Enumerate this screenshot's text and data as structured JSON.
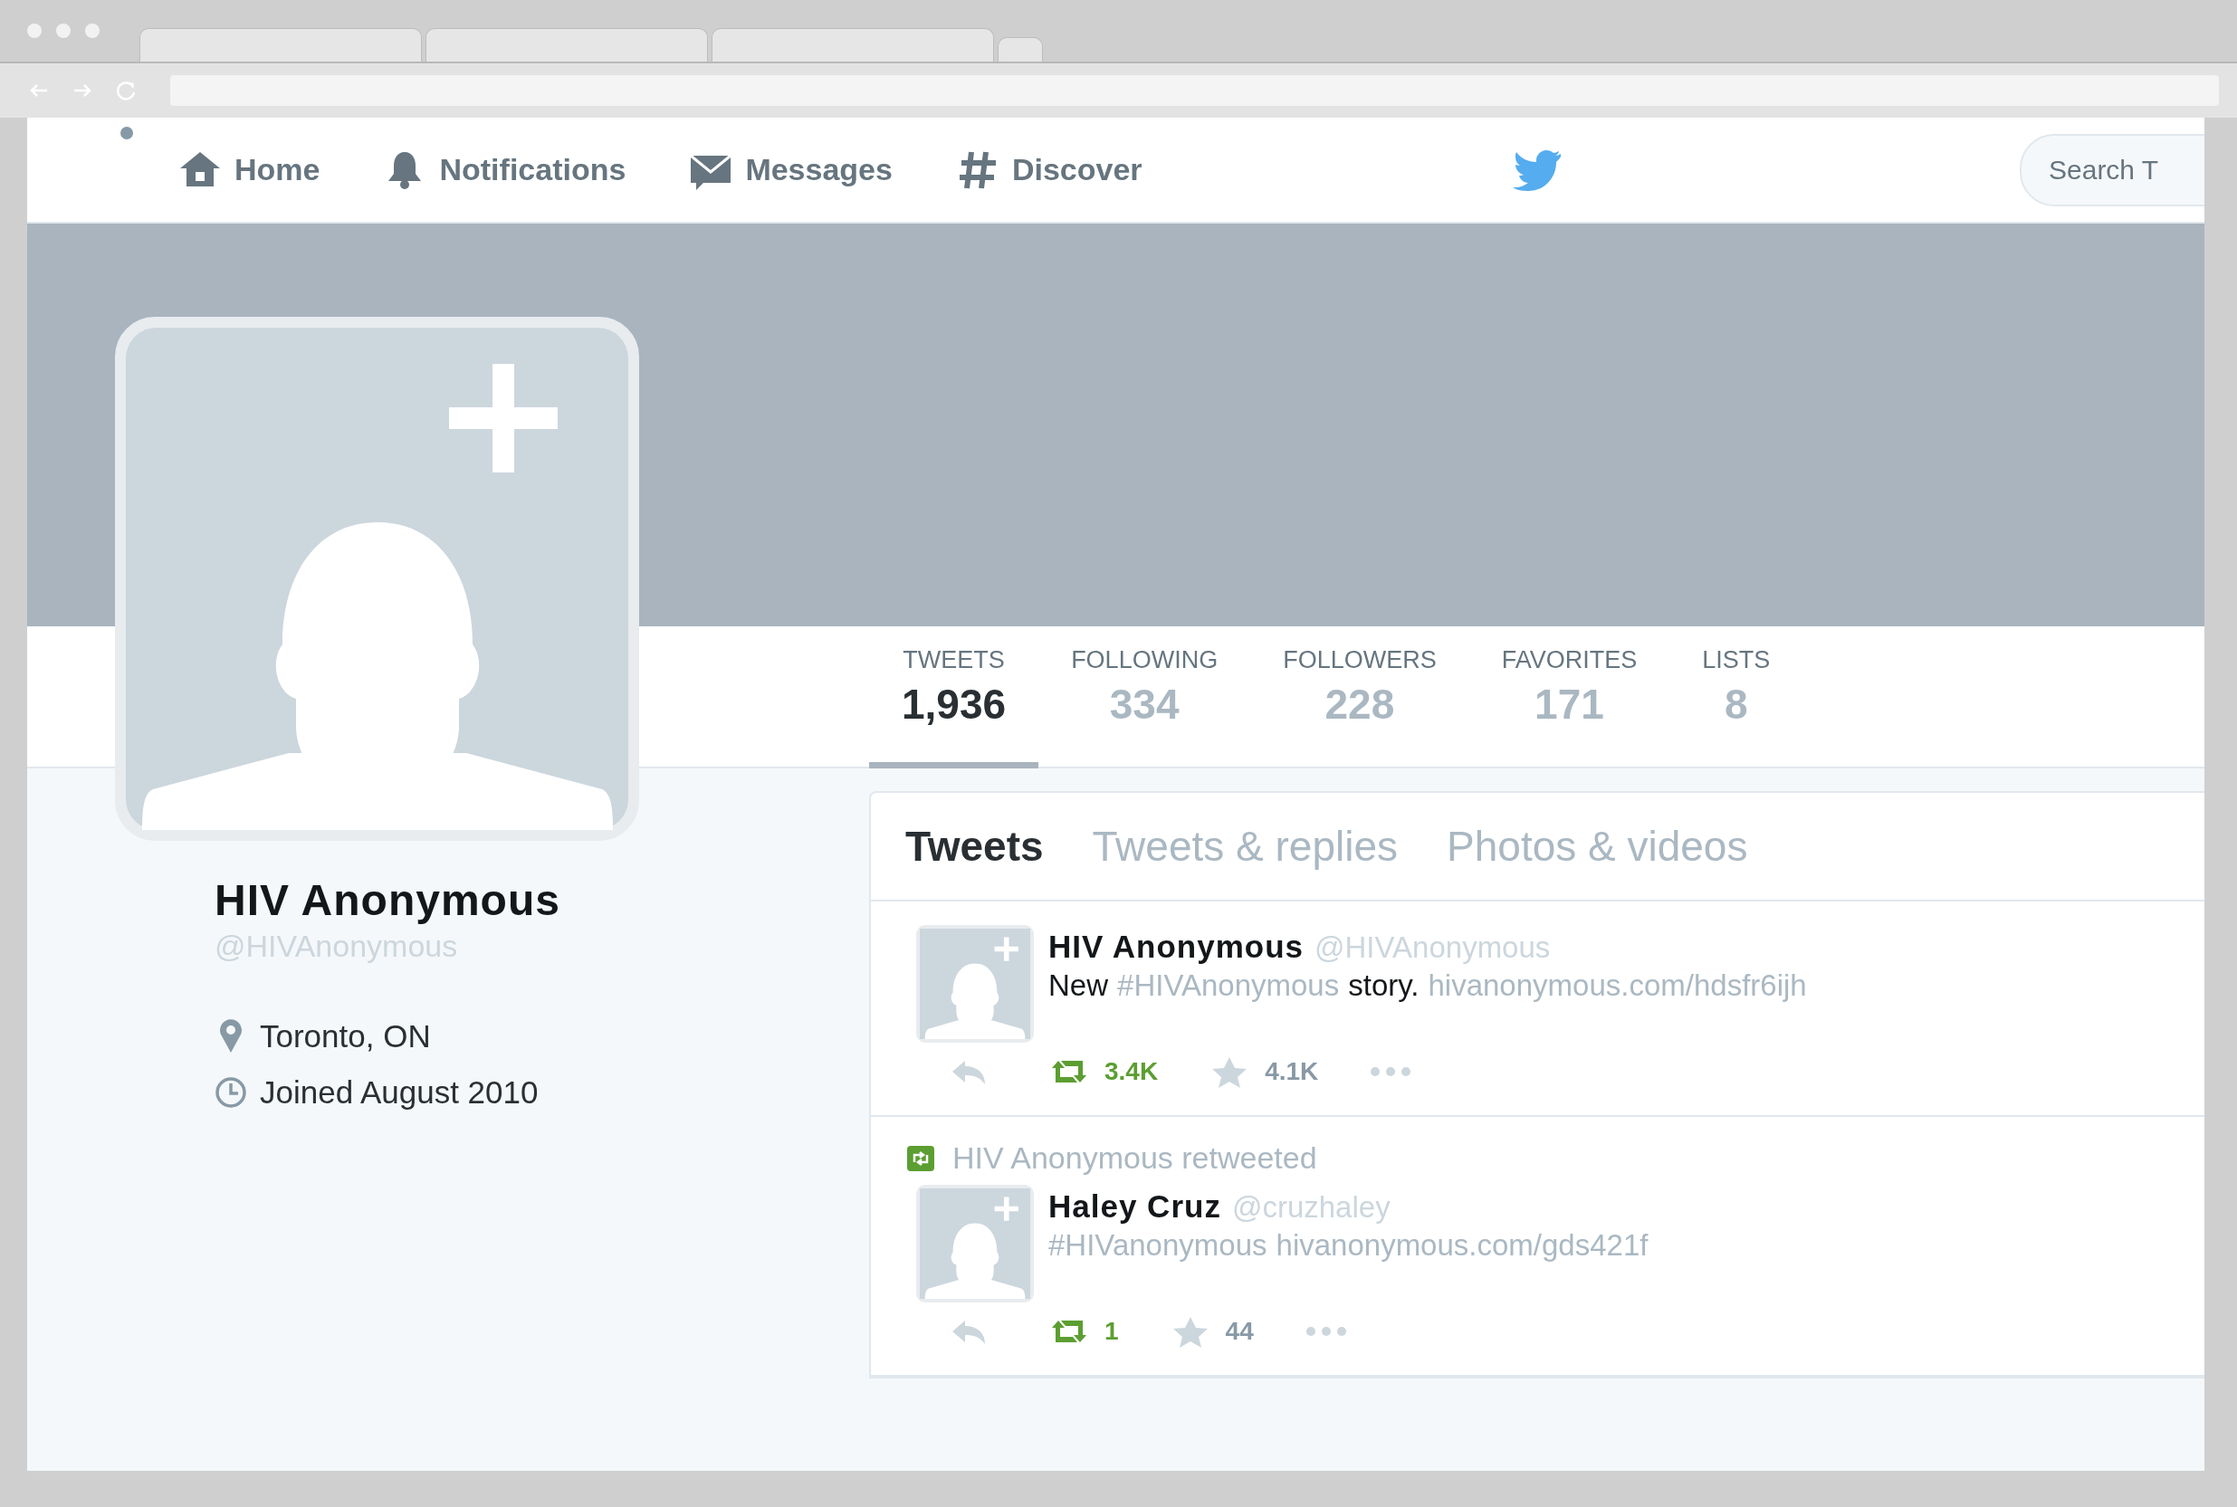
{
  "nav": {
    "items": [
      {
        "label": "Home"
      },
      {
        "label": "Notifications"
      },
      {
        "label": "Messages"
      },
      {
        "label": "Discover"
      }
    ],
    "search": {
      "placeholder": "Search T"
    }
  },
  "profile": {
    "name": "HIV Anonymous",
    "handle": "@HIVAnonymous",
    "location": "Toronto, ON",
    "joined": "Joined August 2010"
  },
  "stats": [
    {
      "label": "TWEETS",
      "value": "1,936",
      "selected": true
    },
    {
      "label": "FOLLOWING",
      "value": "334",
      "selected": false
    },
    {
      "label": "FOLLOWERS",
      "value": "228",
      "selected": false
    },
    {
      "label": "FAVORITES",
      "value": "171",
      "selected": false
    },
    {
      "label": "LISTS",
      "value": "8",
      "selected": false
    }
  ],
  "timeline_tabs": [
    {
      "label": "Tweets",
      "selected": true
    },
    {
      "label": "Tweets & replies",
      "selected": false
    },
    {
      "label": "Photos & videos",
      "selected": false
    }
  ],
  "tweets": [
    {
      "name": "HIV Anonymous",
      "handle": "@HIVAnonymous",
      "segments": [
        {
          "kind": "plain",
          "text": "New"
        },
        {
          "kind": "hashtag",
          "text": "#HIVAnonymous"
        },
        {
          "kind": "plain",
          "text": "story."
        },
        {
          "kind": "link",
          "text": "hivanonymous.com/hdsfr6ijh"
        }
      ],
      "retweets": "3.4K",
      "retweeted": true,
      "favorites": "4.1K",
      "favorited": false
    },
    {
      "context": "HIV Anonymous retweeted",
      "name": "Haley Cruz",
      "handle": "@cruzhaley",
      "segments": [
        {
          "kind": "hashtag",
          "text": "#HIVanonymous"
        },
        {
          "kind": "link",
          "text": "hivanonymous.com/gds421f"
        }
      ],
      "retweets": "1",
      "retweeted": true,
      "favorites": "44",
      "favorited": false
    }
  ]
}
